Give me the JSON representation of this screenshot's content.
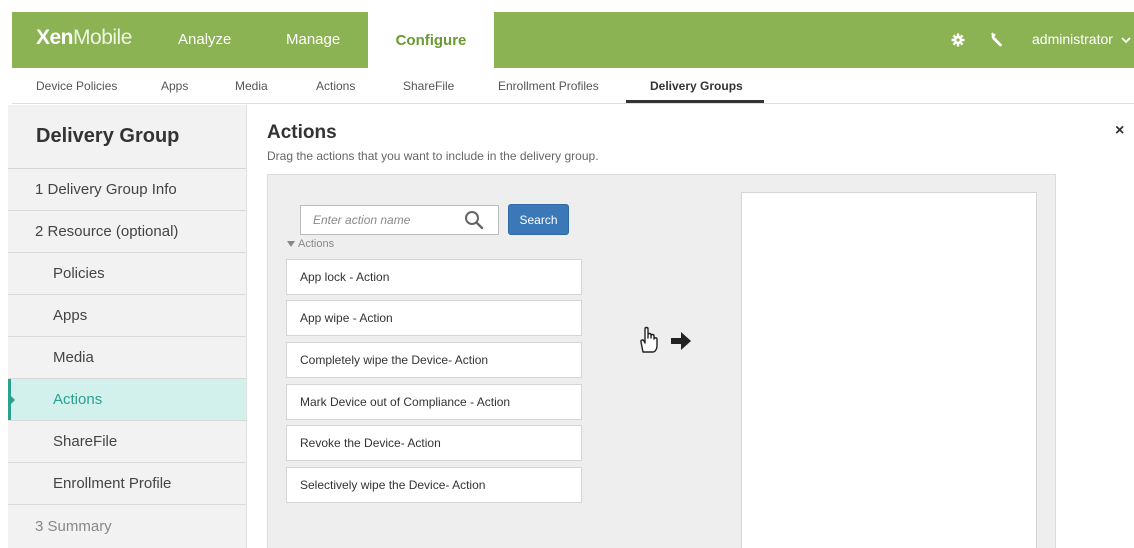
{
  "app": {
    "logo_bold": "Xen",
    "logo_light": "Mobile"
  },
  "topnav": {
    "items": [
      "Analyze",
      "Manage",
      "Configure"
    ],
    "active": "Configure",
    "user": "administrator"
  },
  "icons": {
    "settings": "gear-icon",
    "tools": "wrench-icon",
    "user_menu": "chevron-down-icon",
    "search": "search-icon",
    "close": "close-icon",
    "group_toggle": "caret-down-icon",
    "drag_hint": "hand-pointer-icon"
  },
  "subnav": {
    "items": [
      "Device Policies",
      "Apps",
      "Media",
      "Actions",
      "ShareFile",
      "Enrollment Profiles",
      "Delivery Groups"
    ],
    "active": "Delivery Groups"
  },
  "sidebar": {
    "title": "Delivery Group",
    "items": [
      {
        "label": "1 Delivery Group Info"
      },
      {
        "label": "2 Resource (optional)"
      },
      {
        "label": "Policies"
      },
      {
        "label": "Apps"
      },
      {
        "label": "Media"
      },
      {
        "label": "Actions"
      },
      {
        "label": "ShareFile"
      },
      {
        "label": "Enrollment Profile"
      },
      {
        "label": "3 Summary"
      }
    ],
    "active": "Actions"
  },
  "main": {
    "title": "Actions",
    "subtitle": "Drag the actions that you want to include in the delivery group.",
    "close_label": "×",
    "search": {
      "placeholder": "Enter action name",
      "button_label": "Search"
    },
    "group_label": "Actions",
    "actions": [
      "App lock - Action",
      "App wipe - Action",
      "Completely wipe the Device- Action",
      "Mark Device out of Compliance - Action",
      "Revoke the Device- Action",
      "Selectively wipe the Device- Action"
    ]
  },
  "colors": {
    "header_green": "#8bb253",
    "active_teal": "#2aa08f",
    "active_bg": "#d2f1ec",
    "button_blue": "#3a78b8"
  }
}
